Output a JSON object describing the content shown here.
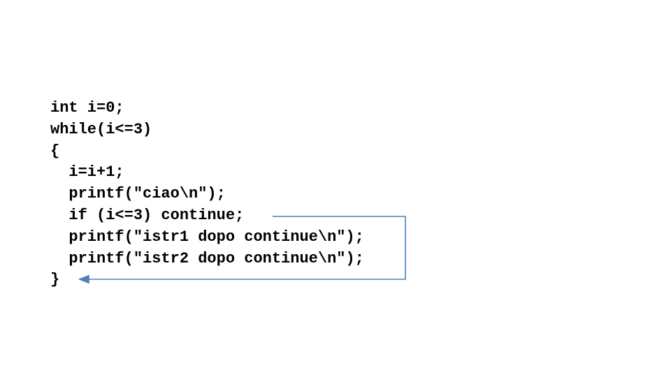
{
  "code": {
    "lines": [
      "int i=0;",
      "while(i<=3)",
      "{",
      "  i=i+1;",
      "  printf(\"ciao\\n\");",
      "  if (i<=3) continue;",
      "  printf(\"istr1 dopo continue\\n\");",
      "  printf(\"istr2 dopo continue\\n\");",
      "}"
    ]
  },
  "arrow_color": "#4a7fbf"
}
